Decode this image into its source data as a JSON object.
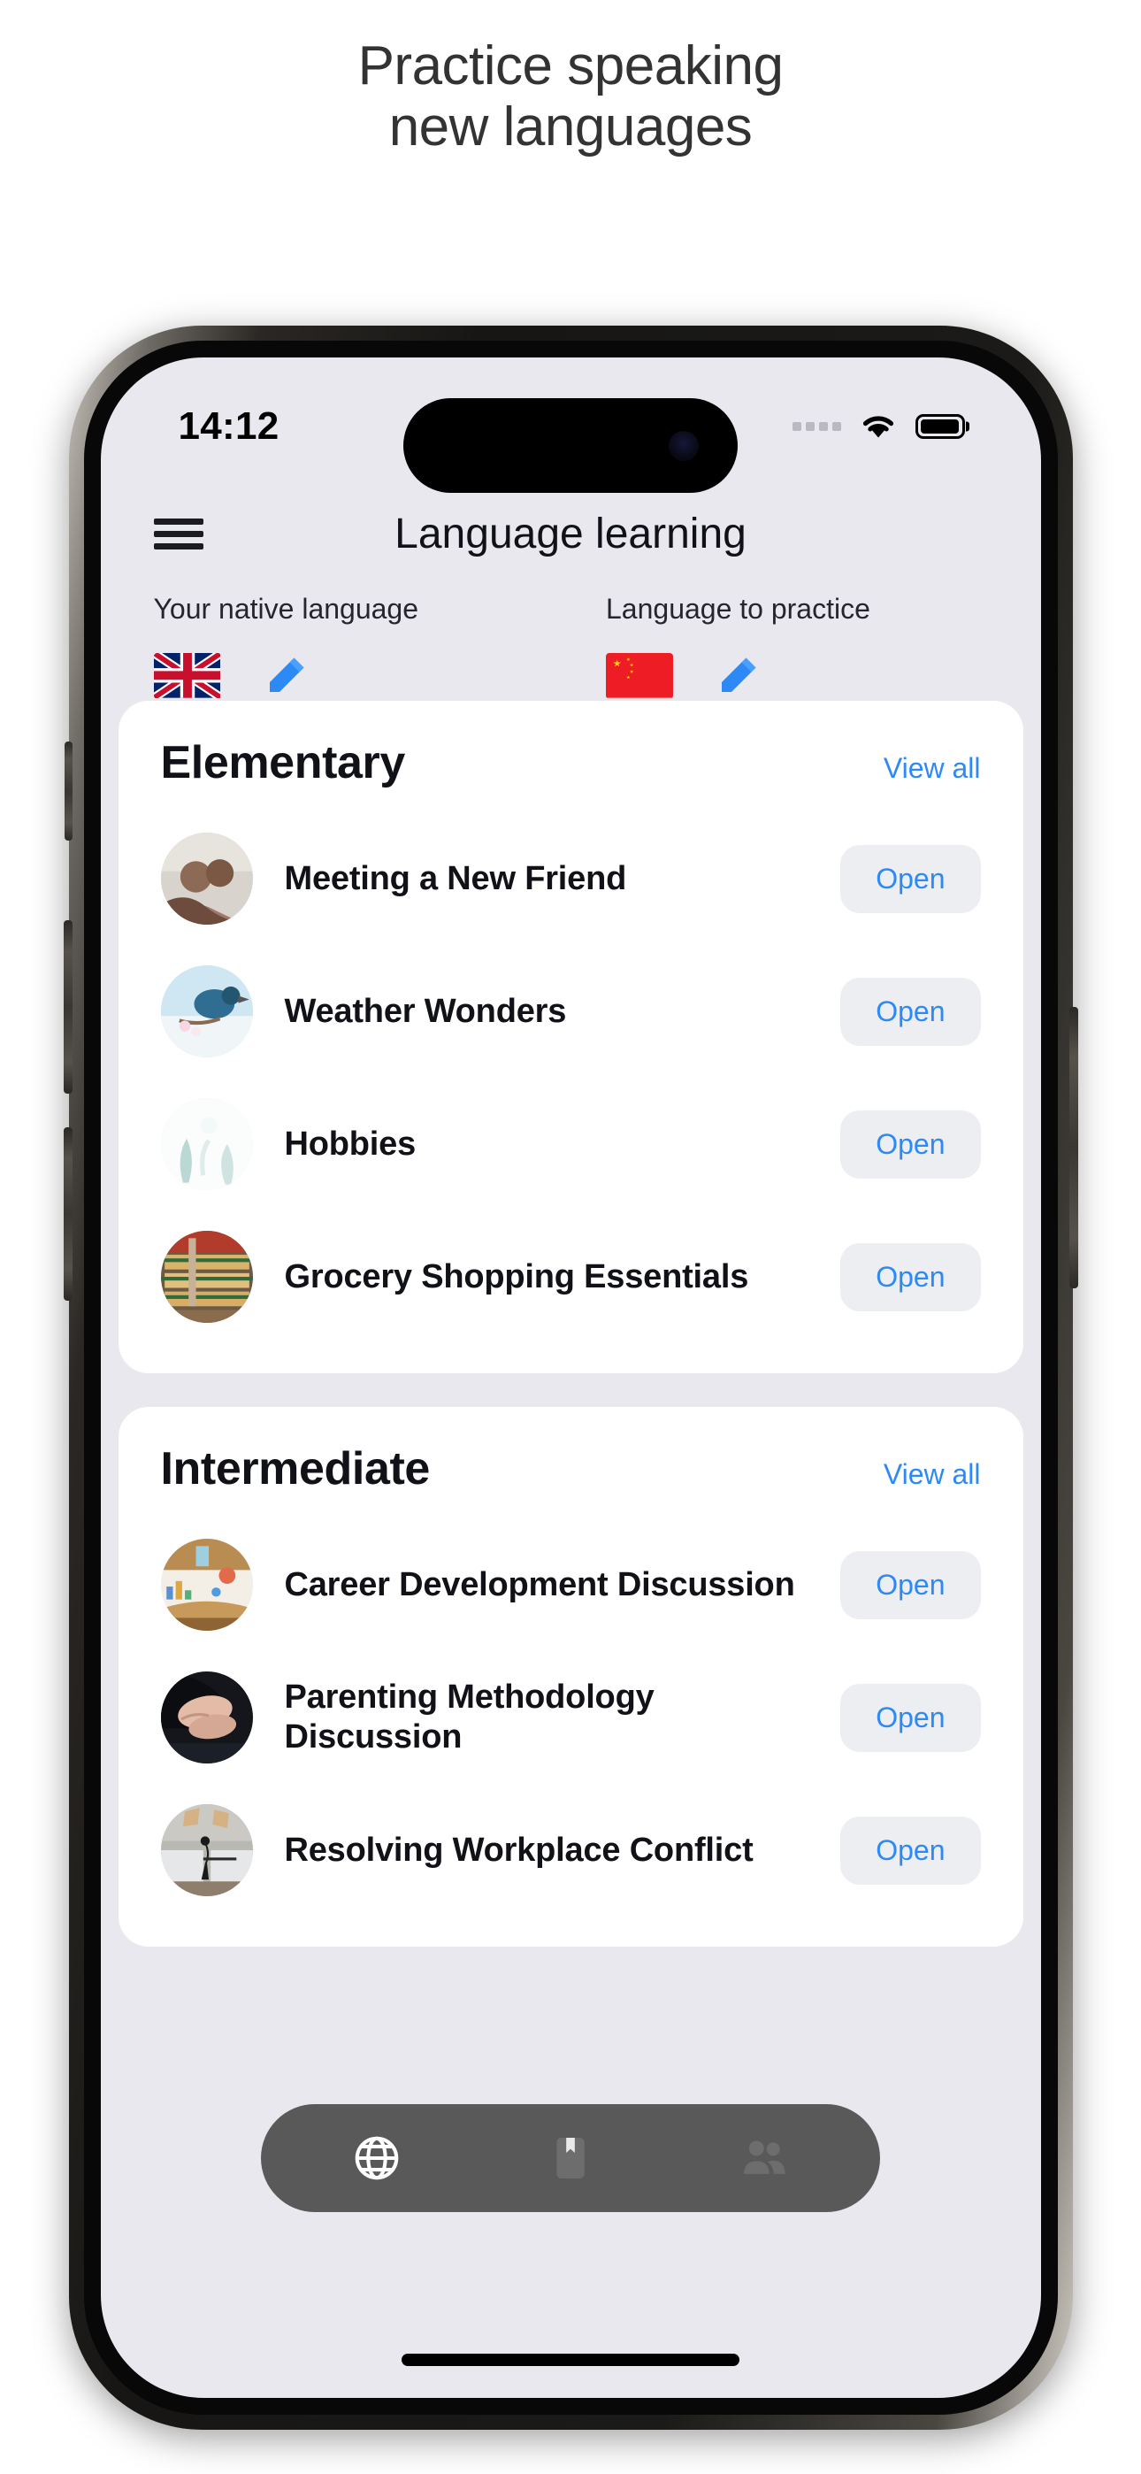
{
  "promo": {
    "line1": "Practice speaking",
    "line2": "new languages"
  },
  "status_bar": {
    "time": "14:12",
    "signal_icon": "signal-dots-icon",
    "wifi_icon": "wifi-icon",
    "battery_icon": "battery-icon"
  },
  "nav": {
    "menu_icon": "hamburger-menu-icon",
    "title": "Language learning"
  },
  "language_selector": {
    "native": {
      "label": "Your native language",
      "flag": "united-kingdom-flag",
      "edit_icon": "pencil-icon"
    },
    "practice": {
      "label": "Language to practice",
      "flag": "china-flag",
      "edit_icon": "pencil-icon"
    }
  },
  "sections": [
    {
      "title": "Elementary",
      "view_all": "View all",
      "lessons": [
        {
          "name": "Meeting a New Friend",
          "open_label": "Open",
          "thumb": "people-photo"
        },
        {
          "name": "Weather Wonders",
          "open_label": "Open",
          "thumb": "bird-photo"
        },
        {
          "name": "Hobbies",
          "open_label": "Open",
          "thumb": "leaves-illustration"
        },
        {
          "name": "Grocery Shopping Essentials",
          "open_label": "Open",
          "thumb": "grocery-photo"
        }
      ]
    },
    {
      "title": "Intermediate",
      "view_all": "View all",
      "lessons": [
        {
          "name": "Career Development Discussion",
          "open_label": "Open",
          "thumb": "career-illustration"
        },
        {
          "name": "Parenting Methodology Discussion",
          "open_label": "Open",
          "thumb": "hands-photo"
        },
        {
          "name": "Resolving Workplace Conflict",
          "open_label": "Open",
          "thumb": "office-photo"
        }
      ]
    }
  ],
  "tabbar": {
    "tabs": [
      {
        "icon": "globe-icon",
        "active": true
      },
      {
        "icon": "bookmark-icon",
        "active": false
      },
      {
        "icon": "people-icon",
        "active": false
      }
    ]
  },
  "colors": {
    "accent_blue": "#2d89f5",
    "app_background": "#e9e8ef",
    "card_background": "#ffffff",
    "open_button_background": "#eceef1",
    "tabbar_background": "#444444"
  }
}
